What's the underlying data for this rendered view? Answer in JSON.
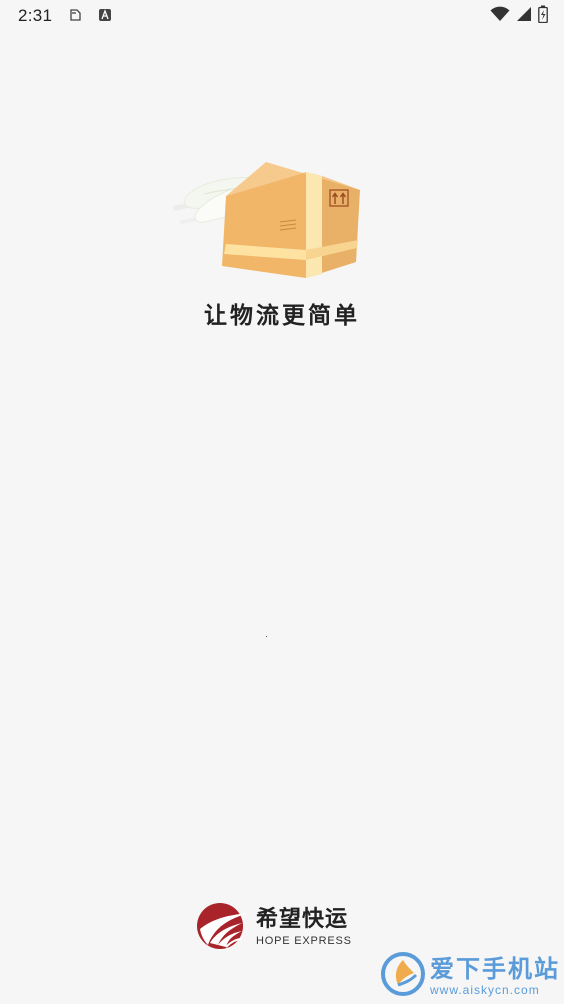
{
  "status_bar": {
    "time": "2:31",
    "icons": [
      "sd-card-icon",
      "text-a-icon",
      "wifi-icon",
      "signal-icon",
      "battery-icon"
    ]
  },
  "splash": {
    "illustration": "winged-package-icon",
    "slogan": "让物流更简单"
  },
  "brand": {
    "name_cn": "希望快运",
    "name_en": "HOPE EXPRESS",
    "color": "#a8242a"
  },
  "watermark": {
    "name_cn": "爱下手机站",
    "url": "www.aiskycn.com",
    "color": "#4a92d6"
  }
}
